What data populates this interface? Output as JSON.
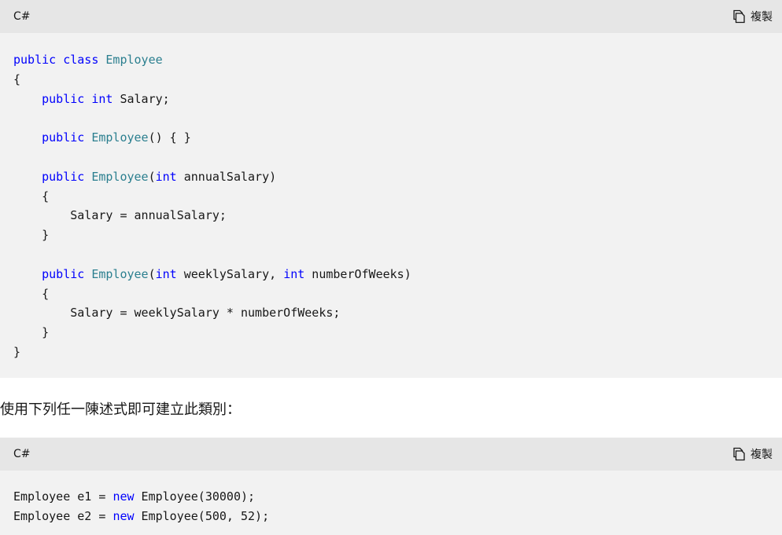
{
  "blocks": [
    {
      "language": "C#",
      "copy_label": "複製",
      "lines": [
        [
          {
            "t": "public",
            "c": "kw"
          },
          {
            "t": " "
          },
          {
            "t": "class",
            "c": "kw"
          },
          {
            "t": " "
          },
          {
            "t": "Employee",
            "c": "ty"
          }
        ],
        [
          {
            "t": "{"
          }
        ],
        [
          {
            "t": "    "
          },
          {
            "t": "public",
            "c": "kw"
          },
          {
            "t": " "
          },
          {
            "t": "int",
            "c": "kw"
          },
          {
            "t": " Salary;"
          }
        ],
        [],
        [
          {
            "t": "    "
          },
          {
            "t": "public",
            "c": "kw"
          },
          {
            "t": " "
          },
          {
            "t": "Employee",
            "c": "ty"
          },
          {
            "t": "() { }"
          }
        ],
        [],
        [
          {
            "t": "    "
          },
          {
            "t": "public",
            "c": "kw"
          },
          {
            "t": " "
          },
          {
            "t": "Employee",
            "c": "ty"
          },
          {
            "t": "("
          },
          {
            "t": "int",
            "c": "kw"
          },
          {
            "t": " annualSalary)"
          }
        ],
        [
          {
            "t": "    {"
          }
        ],
        [
          {
            "t": "        Salary = annualSalary;"
          }
        ],
        [
          {
            "t": "    }"
          }
        ],
        [],
        [
          {
            "t": "    "
          },
          {
            "t": "public",
            "c": "kw"
          },
          {
            "t": " "
          },
          {
            "t": "Employee",
            "c": "ty"
          },
          {
            "t": "("
          },
          {
            "t": "int",
            "c": "kw"
          },
          {
            "t": " weeklySalary, "
          },
          {
            "t": "int",
            "c": "kw"
          },
          {
            "t": " numberOfWeeks)"
          }
        ],
        [
          {
            "t": "    {"
          }
        ],
        [
          {
            "t": "        Salary = weeklySalary * numberOfWeeks;"
          }
        ],
        [
          {
            "t": "    }"
          }
        ],
        [
          {
            "t": "}"
          }
        ]
      ]
    },
    {
      "language": "C#",
      "copy_label": "複製",
      "lines": [
        [
          {
            "t": "Employee e1 = "
          },
          {
            "t": "new",
            "c": "kw"
          },
          {
            "t": " Employee(30000);"
          }
        ],
        [
          {
            "t": "Employee e2 = "
          },
          {
            "t": "new",
            "c": "kw"
          },
          {
            "t": " Employee(500, 52);"
          }
        ]
      ]
    }
  ],
  "prose": "使用下列任一陳述式即可建立此類別：",
  "icons": {
    "copy": "copy-icon"
  },
  "colors": {
    "keyword": "#0101fd",
    "type": "#2b7f8f",
    "code_background": "#f2f2f2",
    "header_background": "#e6e6e6"
  }
}
